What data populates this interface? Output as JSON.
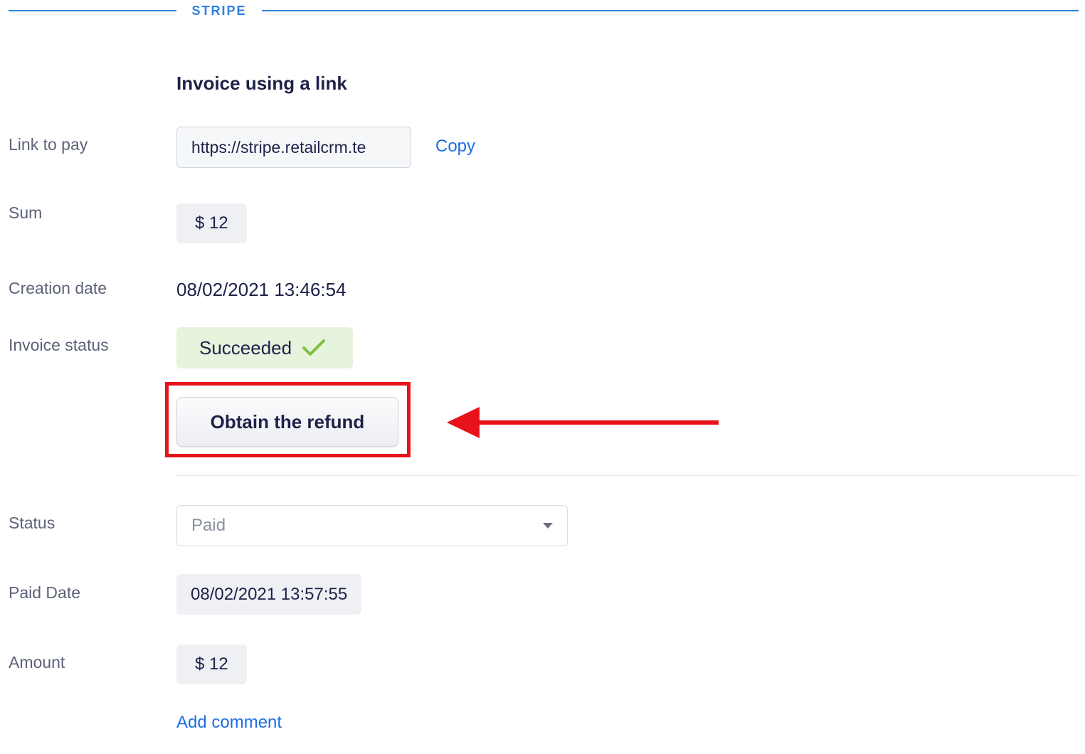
{
  "section": {
    "title": "STRIPE"
  },
  "invoice": {
    "heading": "Invoice using a link",
    "link_label": "Link to pay",
    "link_value": "https://stripe.retailcrm.tе",
    "copy_label": "Copy",
    "sum_label": "Sum",
    "sum_value": "$ 12",
    "creation_label": "Creation date",
    "creation_value": "08/02/2021 13:46:54",
    "status_label": "Invoice status",
    "status_value": "Succeeded",
    "refund_button": "Obtain the refund"
  },
  "payment": {
    "status_label": "Status",
    "status_value": "Paid",
    "paid_date_label": "Paid Date",
    "paid_date_value": "08/02/2021 13:57:55",
    "amount_label": "Amount",
    "amount_value": "$ 12",
    "add_comment": "Add comment"
  },
  "colors": {
    "accent": "#1d6ee2",
    "success_bg": "#e6f4de",
    "success_check": "#7bc043",
    "highlight": "#e8121a"
  },
  "icons": {
    "status_check": "check-icon",
    "select_caret": "caret-down-icon",
    "annotation_arrow": "arrow-left-icon"
  }
}
